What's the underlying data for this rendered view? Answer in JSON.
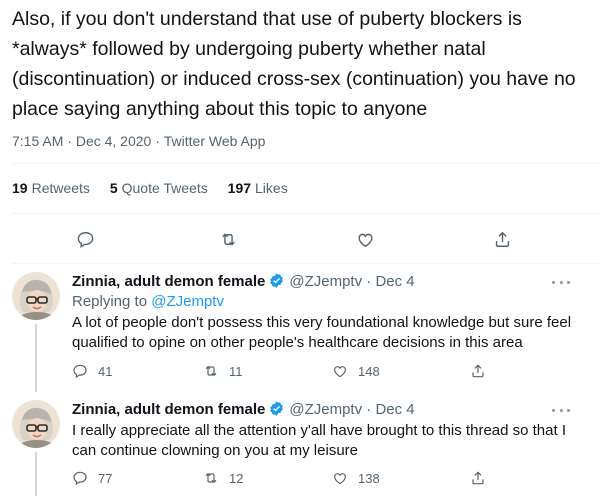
{
  "tweet": {
    "text": "Also, if you don't understand that use of puberty blockers is *always* followed by undergoing puberty whether natal (discontinuation) or induced cross-sex (continuation) you have no place saying anything about this topic to anyone",
    "time": "7:15 AM",
    "dot1": "·",
    "date": "Dec 4, 2020",
    "dot2": "·",
    "source": "Twitter Web App",
    "stats": {
      "retweets_count": "19",
      "retweets_label": "Retweets",
      "quotes_count": "5",
      "quotes_label": "Quote Tweets",
      "likes_count": "197",
      "likes_label": "Likes"
    },
    "actions": [
      "reply-icon",
      "retweet-icon",
      "like-icon",
      "share-icon"
    ]
  },
  "replies": [
    {
      "name": "Zinnia, adult demon female",
      "handle": "@ZJemptv",
      "dot": "·",
      "date": "Dec 4",
      "replying_prefix": "Replying to ",
      "replying_handle": "@ZJemptv",
      "text": "A lot of people don't possess this very foundational knowledge but sure feel qualified to opine on other people's healthcare decisions in this area",
      "reply_count": "41",
      "retweet_count": "11",
      "like_count": "148"
    },
    {
      "name": "Zinnia, adult demon female",
      "handle": "@ZJemptv",
      "dot": "·",
      "date": "Dec 4",
      "text": "I really appreciate all the attention y'all have brought to this thread so that I can continue clowning on you at my leisure",
      "reply_count": "77",
      "retweet_count": "12",
      "like_count": "138"
    }
  ],
  "colors": {
    "text": "#0f1419",
    "muted": "#536471",
    "link": "#1d9bf0",
    "verified": "#1d9bf0",
    "divider": "#eff3f4"
  }
}
